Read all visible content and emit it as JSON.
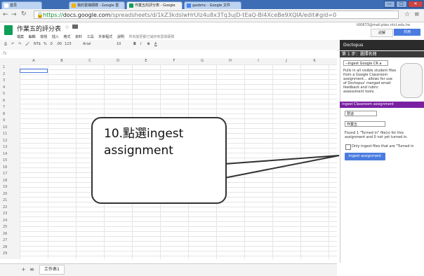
{
  "browser": {
    "tabs": [
      {
        "label": "首頁"
      },
      {
        "label": "我的雲端硬碟 - Google 雲"
      },
      {
        "label": "作業五的評分表 - Google"
      },
      {
        "label": "gasbmc - Google 文件"
      }
    ],
    "url_prefix": "https://",
    "url_domain": "docs.google.com",
    "url_path": "/spreadsheets/d/1kZ3kdslwHrUlz4u8x3Tq3ujD-tEaQ-Bl4XceBe9XQIA/edit#gid=0",
    "win_controls": [
      "—",
      "□",
      "✕"
    ]
  },
  "doc": {
    "title": "作業五的評分表",
    "menu": [
      "檔案",
      "編輯",
      "檢視",
      "插入",
      "格式",
      "資料",
      "工具",
      "外掛程式",
      "說明"
    ],
    "save_status": "所有變更都已儲存到雲端硬碟",
    "user_email": "t00673@mail.ptes.ntct.edu.tw",
    "comment_label": "註解",
    "share_label": "共用"
  },
  "toolbar": {
    "items": [
      "NT$",
      "%",
      ".0",
      ".00",
      "123",
      "Arial",
      "10",
      "B",
      "I",
      "S",
      "A"
    ]
  },
  "grid": {
    "columns": [
      "A",
      "B",
      "C",
      "D",
      "E",
      "F",
      "G",
      "H",
      "I",
      "J",
      "K"
    ],
    "rows": [
      "1",
      "2",
      "3",
      "4",
      "5",
      "6",
      "7",
      "8",
      "9",
      "10",
      "11",
      "12",
      "13",
      "14",
      "15",
      "16",
      "17",
      "18",
      "19",
      "20",
      "21",
      "22",
      "23",
      "24",
      "25",
      "26",
      "27",
      "28",
      "29"
    ],
    "sheet_tab": "工作表1"
  },
  "sidebar": {
    "title": "Doctopus",
    "step": "第 1 步：選擇名冊",
    "roster_select": "--Ingest Google CR a",
    "intro": "Pulls in all visible student files from a Google Classroom assignment... allows for use of Doctopus' merged email feedback and rubric assessment tools.",
    "section": "Ingest Classroom assignment",
    "course_select": "慧道",
    "assignment_select": "作業五",
    "found_text": "Found 1 \"Turned in\" file(s) for this assignment and 0 not yet turned in.",
    "checkbox_label": "Only ingest files that are \"Turned in",
    "ingest_button": "Ingest assignment"
  },
  "callout": {
    "text": "10.點選ingest assignment"
  },
  "colors": {
    "titlebar": "#3d6db5",
    "sheets_green": "#0f9d58",
    "sidebar_section": "#7a1fa2",
    "button_blue": "#4a7ce0"
  }
}
